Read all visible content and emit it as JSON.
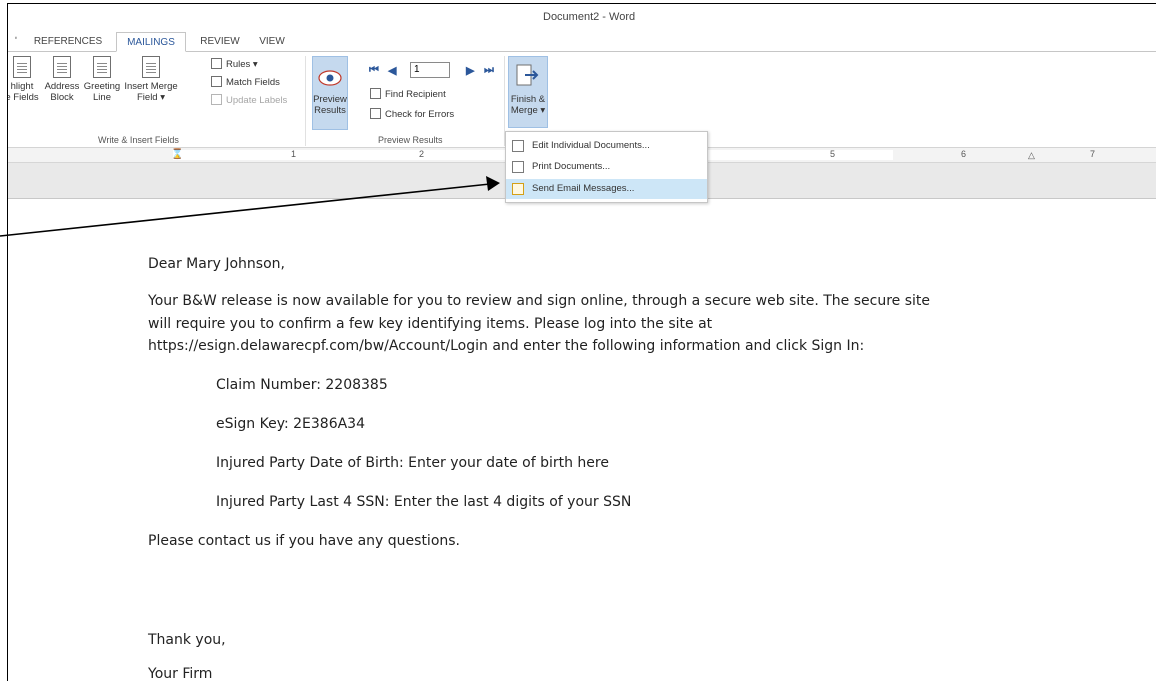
{
  "window": {
    "title": "Document2 - Word"
  },
  "tabs": [
    {
      "label": "REFERENCES"
    },
    {
      "label": "MAILINGS",
      "active": true
    },
    {
      "label": "REVIEW"
    },
    {
      "label": "VIEW"
    }
  ],
  "ribbon": {
    "write_insert": {
      "highlight": {
        "line1": "hlight",
        "line2": "e Fields"
      },
      "address_block": {
        "line1": "Address",
        "line2": "Block"
      },
      "greeting_line": {
        "line1": "Greeting",
        "line2": "Line"
      },
      "insert_merge_field": {
        "line1": "Insert Merge",
        "line2": "Field ▾"
      },
      "rules": "Rules ▾",
      "match_fields": "Match Fields",
      "update_labels": "Update Labels",
      "group_label": "Write & Insert Fields"
    },
    "preview": {
      "preview_results": {
        "line1": "Preview",
        "line2": "Results"
      },
      "record_value": "1",
      "find_recipient": "Find Recipient",
      "check_errors": "Check for Errors",
      "group_label": "Preview Results"
    },
    "finish": {
      "line1": "Finish &",
      "line2": "Merge ▾"
    }
  },
  "finish_menu": {
    "items": [
      {
        "label": "Edit Individual Documents..."
      },
      {
        "label": "Print Documents..."
      },
      {
        "label": "Send Email Messages...",
        "highlighted": true
      }
    ]
  },
  "ruler": {
    "numbers": [
      "1",
      "2",
      "5",
      "6",
      "7"
    ]
  },
  "document": {
    "greeting": "Dear Mary Johnson,",
    "body_line1": "Your B&W release is now available for you to review and sign online, through a secure web site. The secure site",
    "body_line2": "will require you to confirm a few key identifying items. Please log into the site at",
    "body_line3": "https://esign.delawarecpf.com/bw/Account/Login and enter the following information and click Sign In:",
    "claim_number": "Claim Number: 2208385",
    "esign_key": "eSign Key: 2E386A34",
    "dob": "Injured Party Date of Birth: Enter your date of birth here",
    "ssn": "Injured Party Last 4 SSN: Enter the last 4 digits of your SSN",
    "contact": "Please contact us if you have any questions.",
    "thanks": "Thank you,",
    "signature": "Your Firm"
  },
  "colors": {
    "accent": "#2b579a",
    "button_highlight": "#c5d9ee",
    "menu_highlight": "#cde6f7"
  }
}
